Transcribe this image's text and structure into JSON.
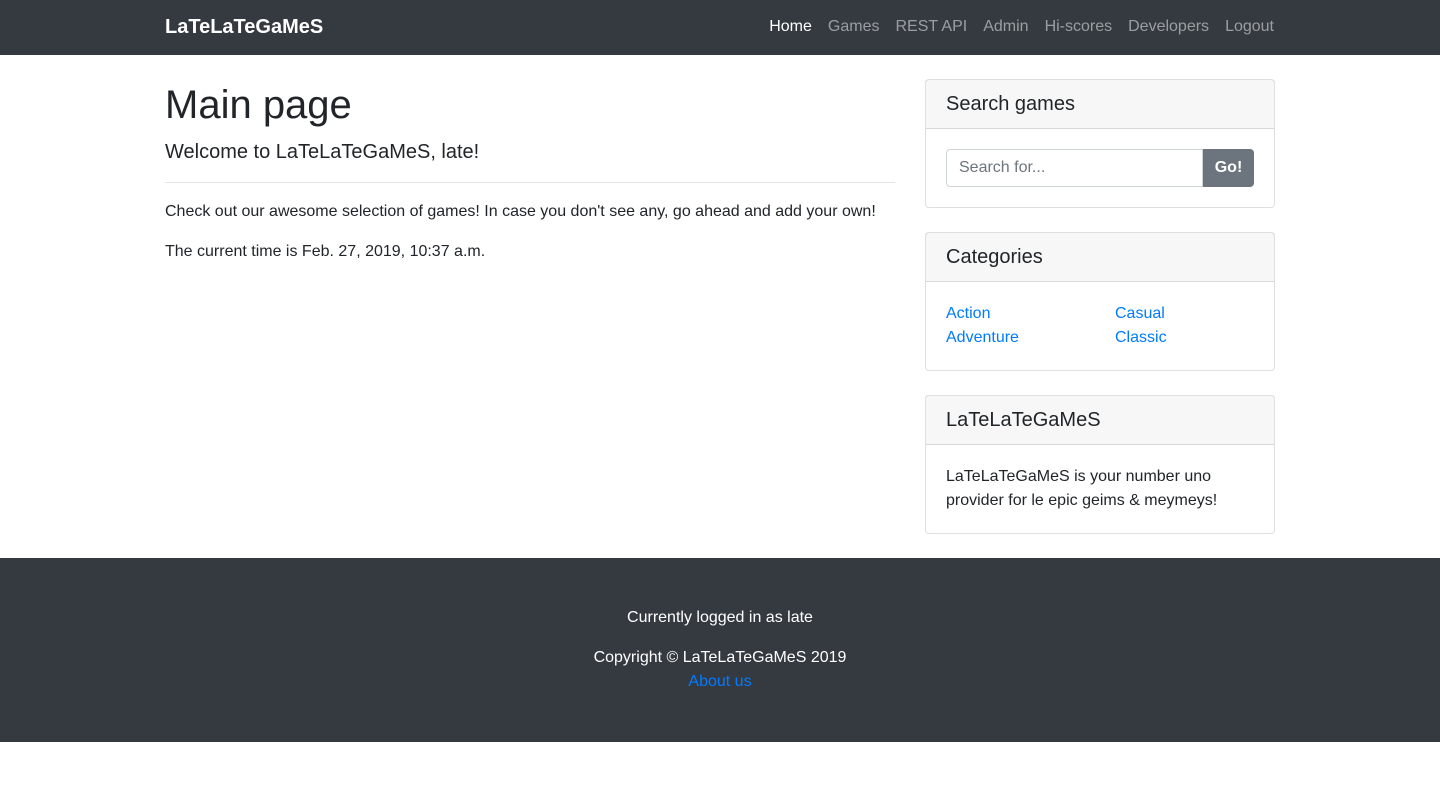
{
  "navbar": {
    "brand": "LaTeLaTeGaMeS",
    "links": [
      {
        "label": "Home",
        "active": true
      },
      {
        "label": "Games",
        "active": false
      },
      {
        "label": "REST API",
        "active": false
      },
      {
        "label": "Admin",
        "active": false
      },
      {
        "label": "Hi-scores",
        "active": false
      },
      {
        "label": "Developers",
        "active": false
      },
      {
        "label": "Logout",
        "active": false
      }
    ]
  },
  "main": {
    "title": "Main page",
    "lead": "Welcome to LaTeLaTeGaMeS, late!",
    "paragraph": "Check out our awesome selection of games! In case you don't see any, go ahead and add your own!",
    "time_text": "The current time is Feb. 27, 2019, 10:37 a.m."
  },
  "search": {
    "header": "Search games",
    "placeholder": "Search for...",
    "value": "",
    "button_label": "Go!"
  },
  "categories": {
    "header": "Categories",
    "items": [
      "Action",
      "Casual",
      "Adventure",
      "Classic"
    ]
  },
  "about_card": {
    "header": "LaTeLaTeGaMeS",
    "text": "LaTeLaTeGaMeS is your number uno provider for le epic geims & meymeys!"
  },
  "footer": {
    "logged_in": "Currently logged in as late",
    "copyright": "Copyright © LaTeLaTeGaMeS 2019",
    "about_link": "About us"
  },
  "colors": {
    "dark_bg": "#343a40",
    "link": "#007bff",
    "button_secondary": "#6c757d"
  }
}
